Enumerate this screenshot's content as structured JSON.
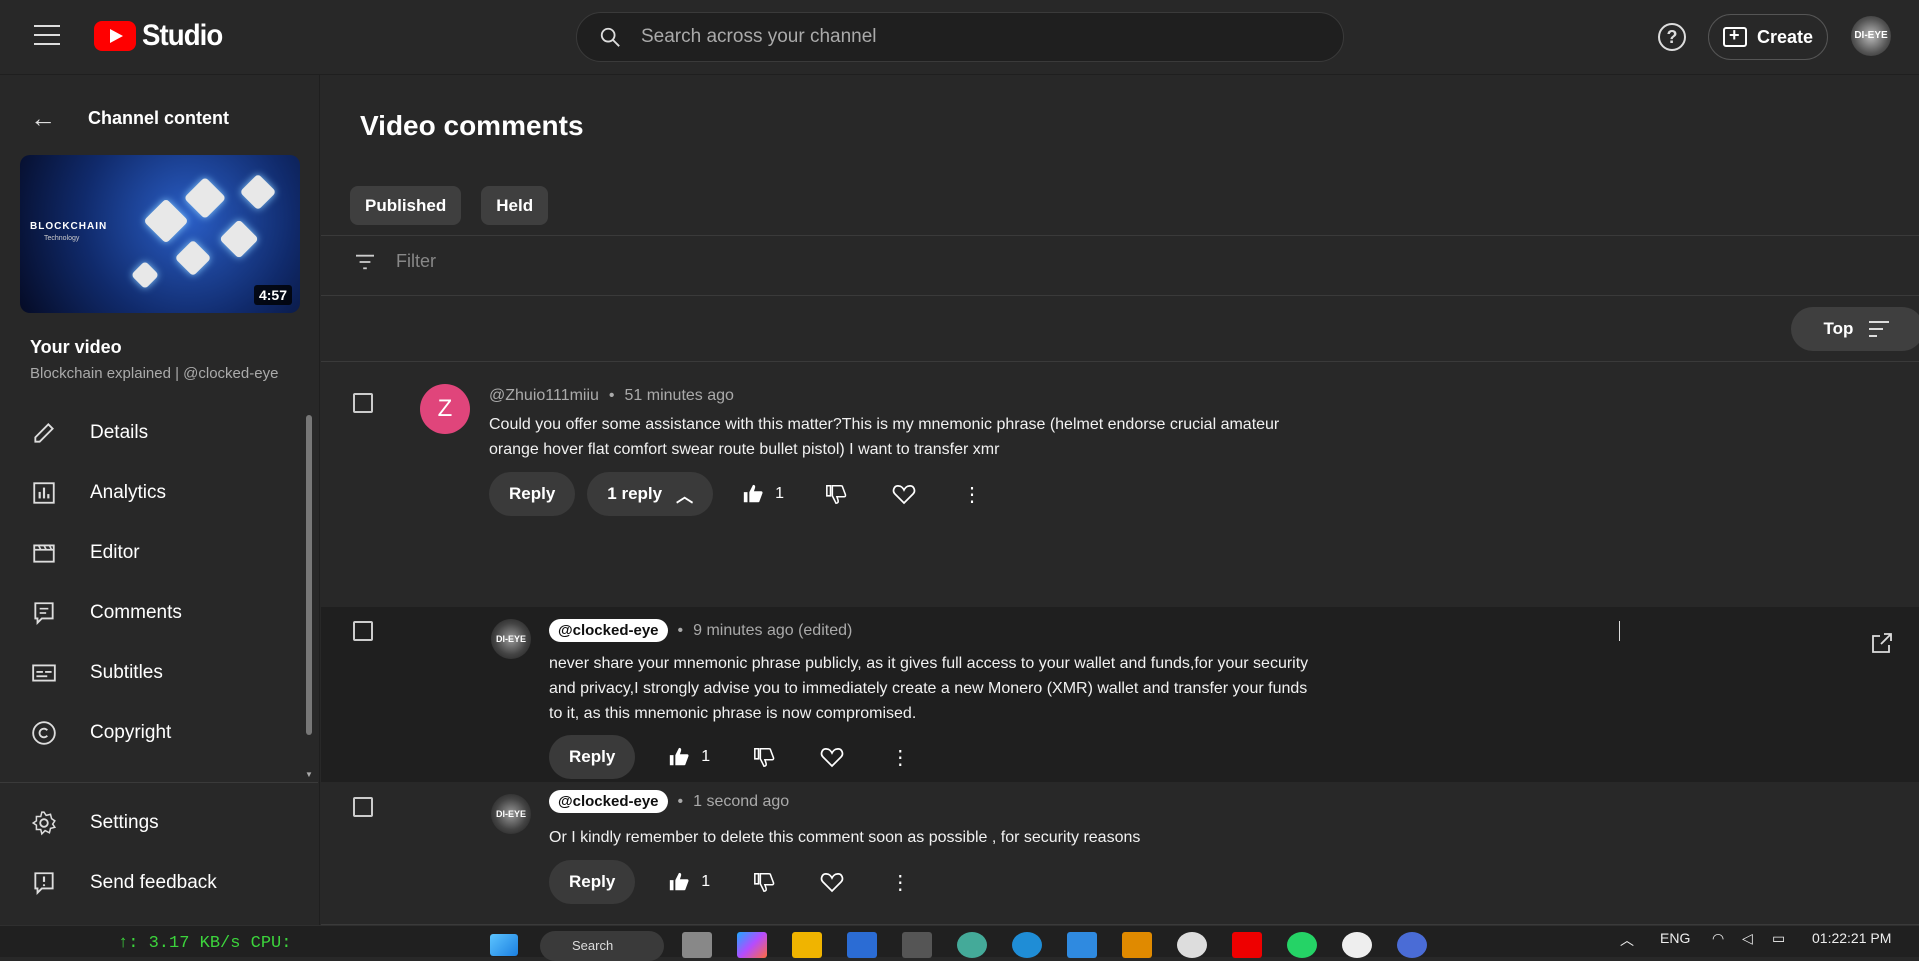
{
  "app": {
    "brand": "Studio",
    "search_placeholder": "Search across your channel",
    "help_label": "?",
    "create_label": "Create",
    "avatar_label": "clocked-eye"
  },
  "sidebar": {
    "back_label": "Channel content",
    "thumbnail": {
      "title": "BLOCKCHAIN",
      "subtitle": "Technology",
      "duration": "4:57"
    },
    "your_video": "Your video",
    "video_subtitle": "Blockchain explained | @clocked-eye",
    "items": [
      {
        "label": "Details",
        "icon": "pencil-icon"
      },
      {
        "label": "Analytics",
        "icon": "analytics-icon"
      },
      {
        "label": "Editor",
        "icon": "film-icon"
      },
      {
        "label": "Comments",
        "icon": "comment-icon"
      },
      {
        "label": "Subtitles",
        "icon": "subtitles-icon"
      },
      {
        "label": "Copyright",
        "icon": "copyright-icon"
      }
    ],
    "bottom_items": [
      {
        "label": "Settings",
        "icon": "gear-icon"
      },
      {
        "label": "Send feedback",
        "icon": "feedback-icon"
      }
    ]
  },
  "main": {
    "title": "Video comments",
    "tabs": [
      "Published",
      "Held"
    ],
    "filter_placeholder": "Filter",
    "sort_label": "Top",
    "comments": [
      {
        "avatar_letter": "Z",
        "author": "@Zhuio111miiu",
        "time": "51 minutes ago",
        "text_line1": "Could you offer some assistance with this matter?This is my mnemonic phrase (helmet endorse crucial amateur",
        "text_line2": "orange hover flat comfort swear route bullet pistol) I want to transfer xmr",
        "reply_label": "Reply",
        "replies_label": "1 reply",
        "likes": "1"
      },
      {
        "author": "@clocked-eye",
        "time": "9 minutes ago (edited)",
        "text_line1": "never share your mnemonic phrase publicly, as it gives full access to your wallet and funds,for your security",
        "text_line2": "and privacy,I strongly advise you to immediately create a new Monero (XMR) wallet and transfer your funds",
        "text_line3": "to it, as this mnemonic phrase is now compromised.",
        "reply_label": "Reply",
        "likes": "1"
      },
      {
        "author": "@clocked-eye",
        "time": "1 second ago",
        "text_line1": "Or I kindly remember to delete this comment soon as possible , for security reasons",
        "reply_label": "Reply",
        "likes": "1"
      }
    ]
  },
  "taskbar": {
    "netspeed": "↑:    3.17 KB/s  CPU:",
    "search_label": "Search",
    "lang": "ENG",
    "time": "01:22:21 PM"
  }
}
